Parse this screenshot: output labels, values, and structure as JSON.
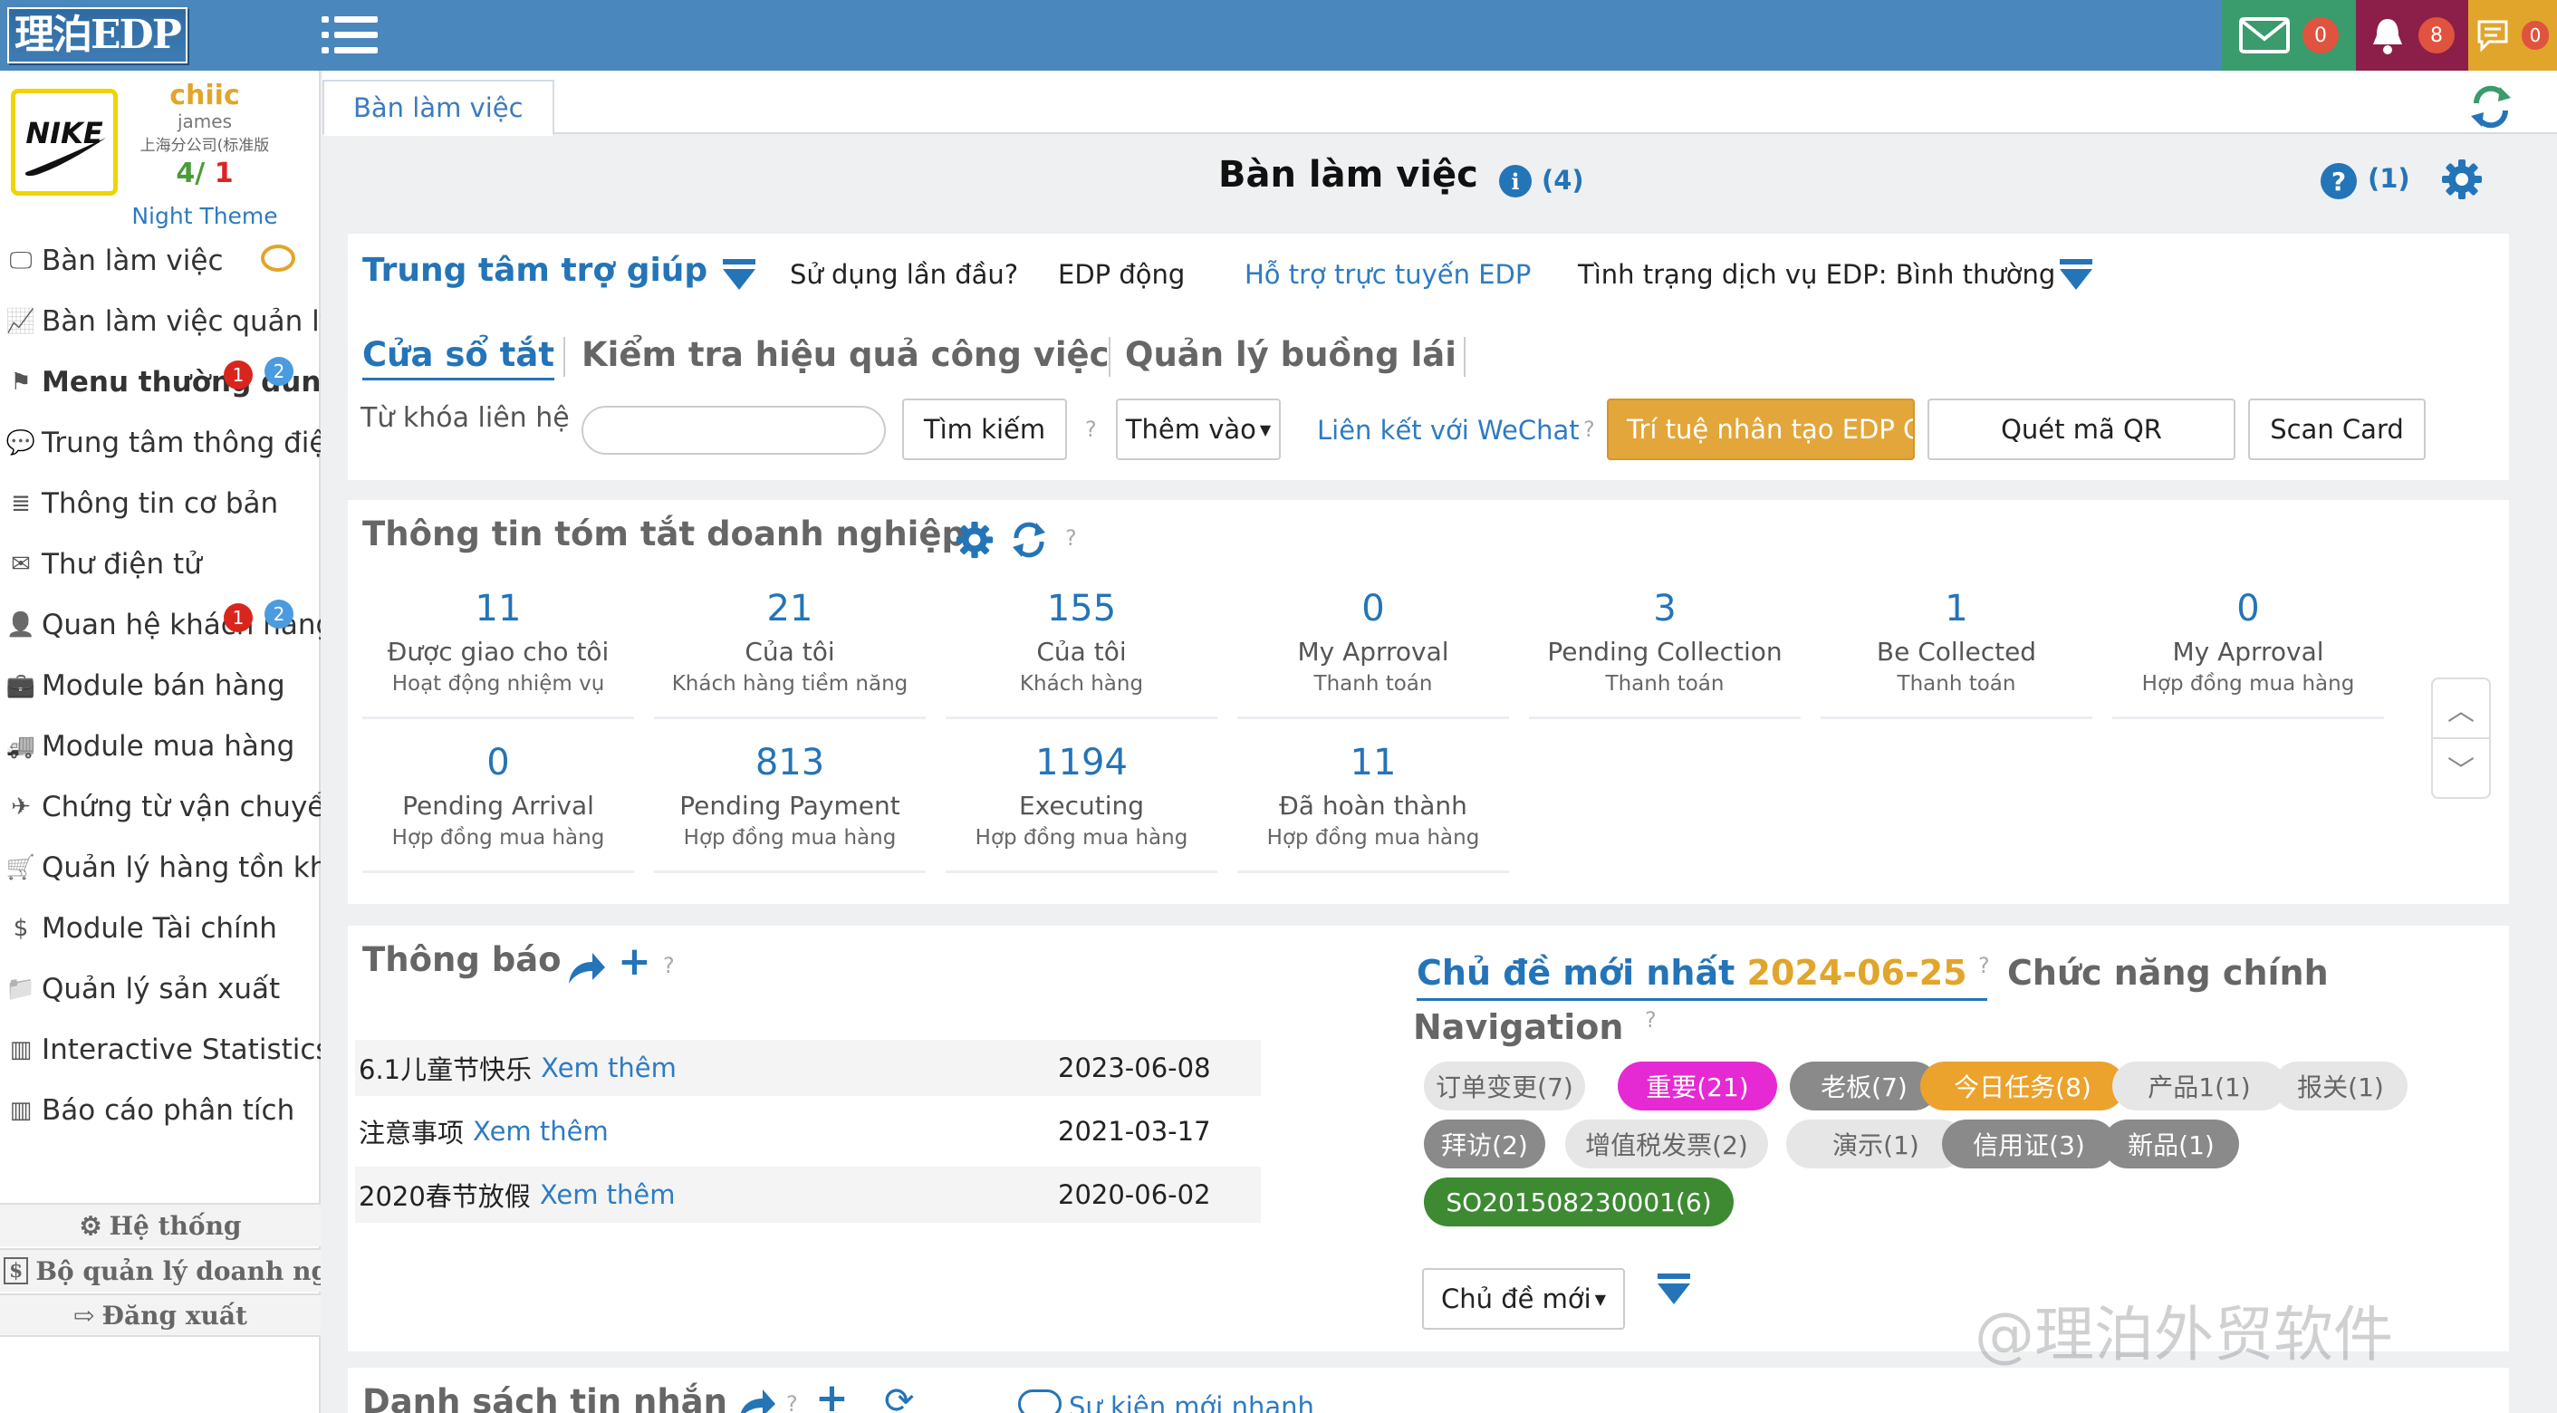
{
  "topbar": {
    "logo_text": "理泊EDP",
    "mail_count": "0",
    "bell_count": "8",
    "message_count": "0",
    "colors": {
      "bar": "#4a87bd",
      "mail_bg": "#3a9b6c",
      "bell_bg": "#8b1f4a",
      "msg_bg": "#e1a52b"
    }
  },
  "profile": {
    "name": "chiic",
    "username": "james",
    "company": "上海分公司(标准版",
    "ratio_a": "4/",
    "ratio_b": "1",
    "theme_link": "Night Theme"
  },
  "sidebar": {
    "items": [
      {
        "label": "Bàn làm việc",
        "icon": "monitor-icon"
      },
      {
        "label": "Bàn làm việc quản lý",
        "icon": "chart-line-icon"
      },
      {
        "label": "Menu thường dùng",
        "icon": "flag-icon",
        "badge_red": "1",
        "badge_blue": "2"
      },
      {
        "label": "Trung tâm thông điệp",
        "icon": "chat-bubble-icon"
      },
      {
        "label": "Thông tin cơ bản",
        "icon": "database-icon"
      },
      {
        "label": "Thư điện tử",
        "icon": "envelope-icon"
      },
      {
        "label": "Quan hệ khách hàng",
        "icon": "user-icon",
        "badge_red": "1",
        "badge_blue": "2"
      },
      {
        "label": "Module bán hàng",
        "icon": "briefcase-icon"
      },
      {
        "label": "Module mua hàng",
        "icon": "truck-icon"
      },
      {
        "label": "Chứng từ vận chuyển",
        "icon": "plane-icon"
      },
      {
        "label": "Quản lý hàng tồn kho",
        "icon": "cart-icon"
      },
      {
        "label": "Module Tài chính",
        "icon": "money-icon"
      },
      {
        "label": "Quản lý sản xuất",
        "icon": "folder-icon"
      },
      {
        "label": "Interactive Statistics",
        "icon": "bar-chart-icon"
      },
      {
        "label": "Báo cáo phân tích",
        "icon": "bar-chart-icon"
      }
    ],
    "bottom": {
      "system": "Hệ thống",
      "enterprise": "Bộ quản lý doanh nghiệp",
      "logout": "Đăng xuất"
    }
  },
  "tabs": {
    "main": "Bàn làm việc"
  },
  "header": {
    "title": "Bàn làm việc",
    "info_count": "(4)",
    "help_count": "(1)"
  },
  "help_center": {
    "title": "Trung tâm trợ giúp",
    "first_use": "Sử dụng lần đầu?",
    "edp_dynamic": "EDP động",
    "online_support": "Hỗ trợ trực tuyến EDP",
    "service_status": "Tình trạng dịch vụ EDP: Bình thường"
  },
  "shortcut_tabs": [
    "Cửa sổ tắt",
    "Kiểm tra hiệu quả công việc",
    "Quản lý buồng lái"
  ],
  "search": {
    "label": "Từ khóa liên hệ",
    "placeholder": "",
    "search_button": "Tìm kiếm",
    "add_dropdown": "Thêm vào",
    "wechat_link": "Liên kết với WeChat",
    "ai_button": "Trí tuệ nhân tạo EDP Q",
    "qr_button": "Quét mã QR",
    "scan_card": "Scan Card"
  },
  "summary": {
    "title": "Thông tin tóm tắt doanh nghiệp",
    "stats": [
      {
        "num": "11",
        "label": "Được giao cho tôi",
        "sub": "Hoạt động nhiệm vụ"
      },
      {
        "num": "21",
        "label": "Của tôi",
        "sub": "Khách hàng tiềm năng"
      },
      {
        "num": "155",
        "label": "Của tôi",
        "sub": "Khách hàng"
      },
      {
        "num": "0",
        "label": "My Aprroval",
        "sub": "Thanh toán"
      },
      {
        "num": "3",
        "label": "Pending Collection",
        "sub": "Thanh toán"
      },
      {
        "num": "1",
        "label": "Be Collected",
        "sub": "Thanh toán"
      },
      {
        "num": "0",
        "label": "My Aprroval",
        "sub": "Hợp đồng mua hàng"
      },
      {
        "num": "0",
        "label": "Pending Arrival",
        "sub": "Hợp đồng mua hàng"
      },
      {
        "num": "813",
        "label": "Pending Payment",
        "sub": "Hợp đồng mua hàng"
      },
      {
        "num": "1194",
        "label": "Executing",
        "sub": "Hợp đồng mua hàng"
      },
      {
        "num": "11",
        "label": "Đã hoàn thành",
        "sub": "Hợp đồng mua hàng"
      }
    ]
  },
  "notices": {
    "title": "Thông báo",
    "more": "Xem thêm",
    "rows": [
      {
        "title": "6.1儿童节快乐",
        "date": "2023-06-08"
      },
      {
        "title": "注意事项",
        "date": "2021-03-17"
      },
      {
        "title": "2020春节放假",
        "date": "2020-06-02"
      }
    ]
  },
  "topics": {
    "latest_label": "Chủ đề mới nhất",
    "latest_date": "2024-06-25",
    "main_functions": "Chức năng chính",
    "navigation": "Navigation",
    "tags": [
      {
        "label": "订单变更(7)",
        "style": "grey"
      },
      {
        "label": "重要(21)",
        "style": "magenta"
      },
      {
        "label": "老板(7)",
        "style": "dark"
      },
      {
        "label": "今日任务(8)",
        "style": "orange"
      },
      {
        "label": "产品1(1)",
        "style": "grey"
      },
      {
        "label": "报关(1)",
        "style": "grey"
      },
      {
        "label": "拜访(2)",
        "style": "dark"
      },
      {
        "label": "增值税发票(2)",
        "style": "grey"
      },
      {
        "label": "演示(1)",
        "style": "grey"
      },
      {
        "label": "信用证(3)",
        "style": "dark"
      },
      {
        "label": "新品(1)",
        "style": "dark"
      },
      {
        "label": "SO201508230001(6)",
        "style": "green"
      }
    ],
    "new_topic_dropdown": "Chủ đề mới"
  },
  "messages": {
    "title": "Danh sách tin nhắn",
    "quick_event": "Sự kiện mới nhanh"
  },
  "watermark": "@理泊外贸软件"
}
